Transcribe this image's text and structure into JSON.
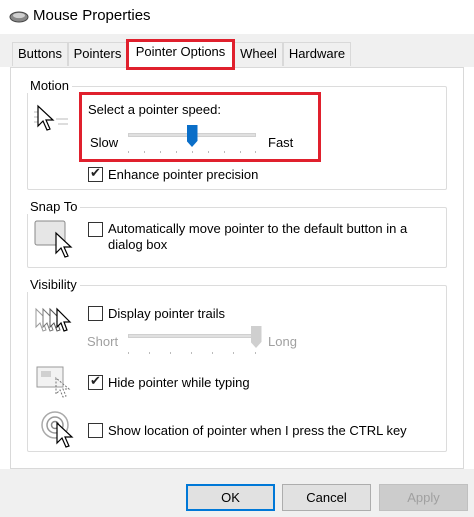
{
  "window": {
    "title": "Mouse Properties",
    "icon": "mouse-icon"
  },
  "tabs": [
    {
      "label": "Buttons",
      "active": false
    },
    {
      "label": "Pointers",
      "active": false
    },
    {
      "label": "Pointer Options",
      "active": true
    },
    {
      "label": "Wheel",
      "active": false
    },
    {
      "label": "Hardware",
      "active": false
    }
  ],
  "motion": {
    "group_label": "Motion",
    "speed_label": "Select a pointer speed:",
    "slow_label": "Slow",
    "fast_label": "Fast",
    "speed_value": 0.5,
    "enhance_precision_label": "Enhance pointer precision",
    "enhance_precision_checked": true
  },
  "snap_to": {
    "group_label": "Snap To",
    "checkbox_label_line1": "Automatically move pointer to the default button in a",
    "checkbox_label_line2": "dialog box",
    "checked": false
  },
  "visibility": {
    "group_label": "Visibility",
    "trails_label": "Display pointer trails",
    "trails_checked": false,
    "short_label": "Short",
    "long_label": "Long",
    "trails_value": 1.0,
    "hide_typing_label": "Hide pointer while typing",
    "hide_typing_checked": true,
    "show_location_label": "Show location of pointer when I press the CTRL key",
    "show_location_checked": false
  },
  "buttons": {
    "ok": "OK",
    "cancel": "Cancel",
    "apply": "Apply"
  },
  "colors": {
    "highlight": "#e0202d",
    "accent": "#0a6ec8"
  }
}
